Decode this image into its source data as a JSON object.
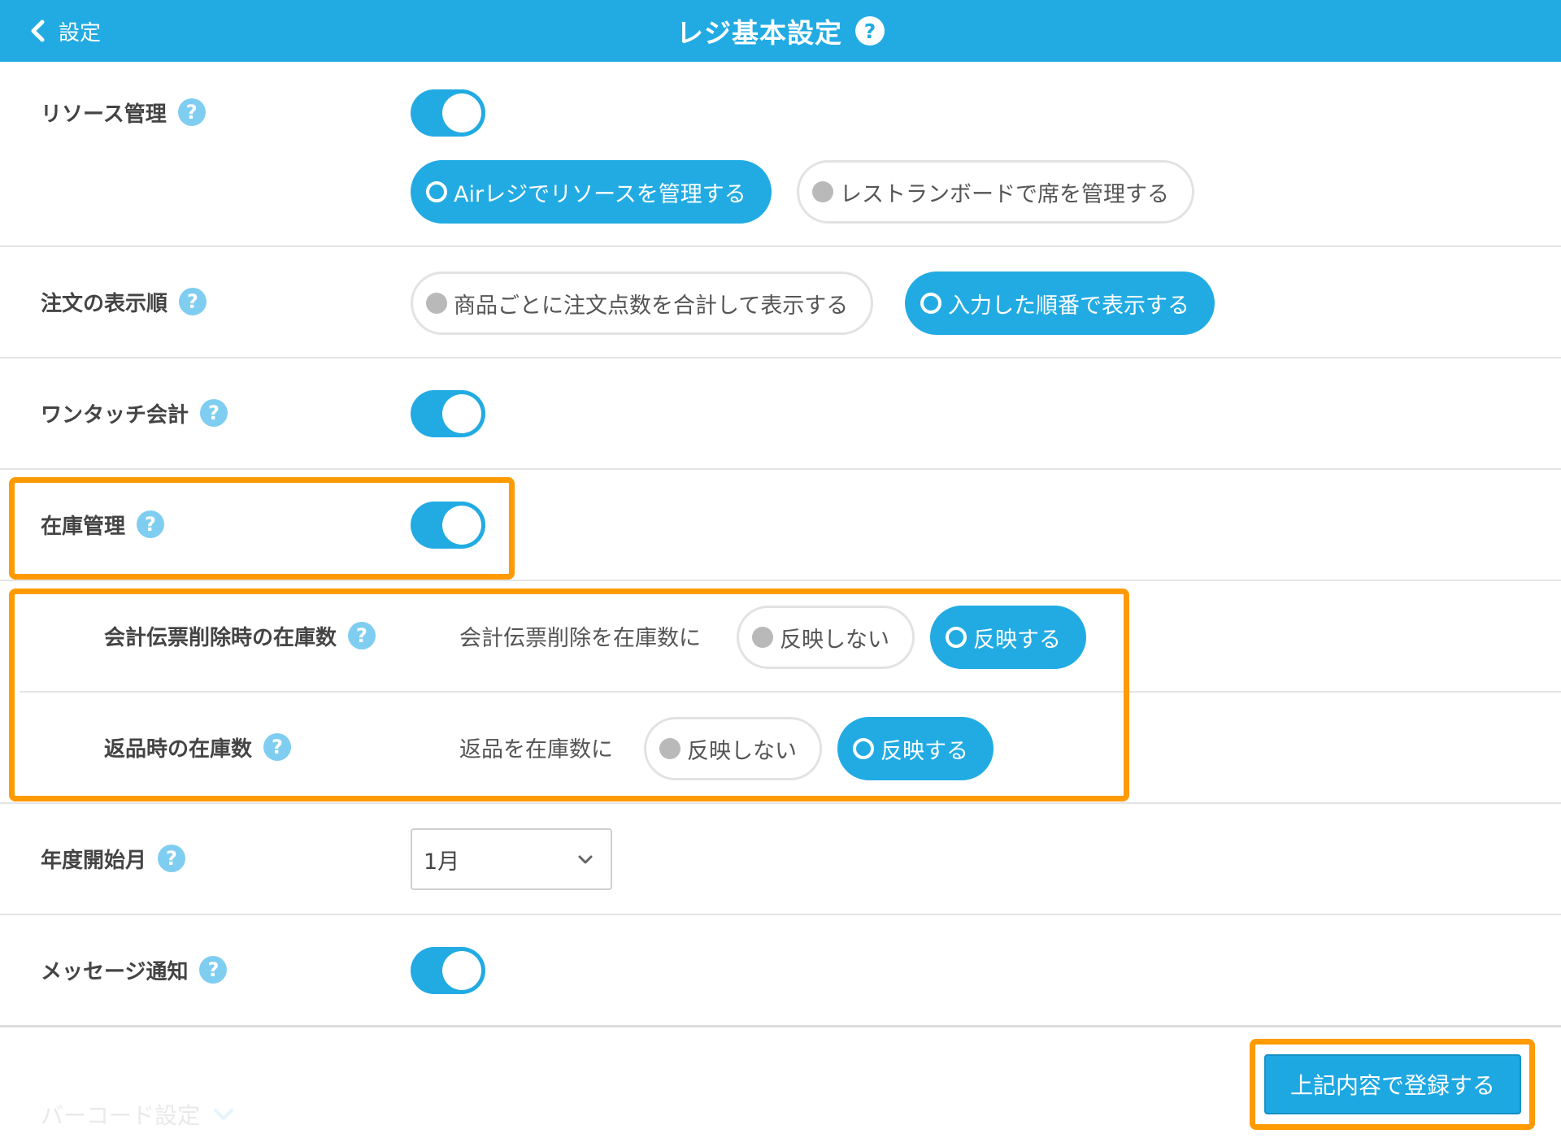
{
  "header": {
    "back_label": "設定",
    "title": "レジ基本設定",
    "help": "?"
  },
  "help_mark": "?",
  "resource": {
    "label": "リソース管理",
    "toggle_on": true,
    "option_air": "Airレジでリソースを管理する",
    "option_board": "レストランボードで席を管理する",
    "selected": "option_air"
  },
  "order_display": {
    "label": "注文の表示順",
    "option_sum": "商品ごとに注文点数を合計して表示する",
    "option_input": "入力した順番で表示する",
    "selected": "option_input"
  },
  "one_touch": {
    "label": "ワンタッチ会計",
    "toggle_on": true
  },
  "inventory": {
    "label": "在庫管理",
    "toggle_on": true
  },
  "slip_delete": {
    "label": "会計伝票削除時の在庫数",
    "prompt": "会計伝票削除を在庫数に",
    "option_no": "反映しない",
    "option_yes": "反映する",
    "selected": "option_yes"
  },
  "return_stock": {
    "label": "返品時の在庫数",
    "prompt": "返品を在庫数に",
    "option_no": "反映しない",
    "option_yes": "反映する",
    "selected": "option_yes"
  },
  "fiscal_start": {
    "label": "年度開始月",
    "value": "1月"
  },
  "message": {
    "label": "メッセージ通知",
    "toggle_on": true
  },
  "footer": {
    "submit_label": "上記内容で登録する",
    "barcode_label": "バーコード設定"
  },
  "colors": {
    "primary": "#22abe3",
    "highlight": "#ff9a00",
    "help": "#7fcdf0"
  }
}
